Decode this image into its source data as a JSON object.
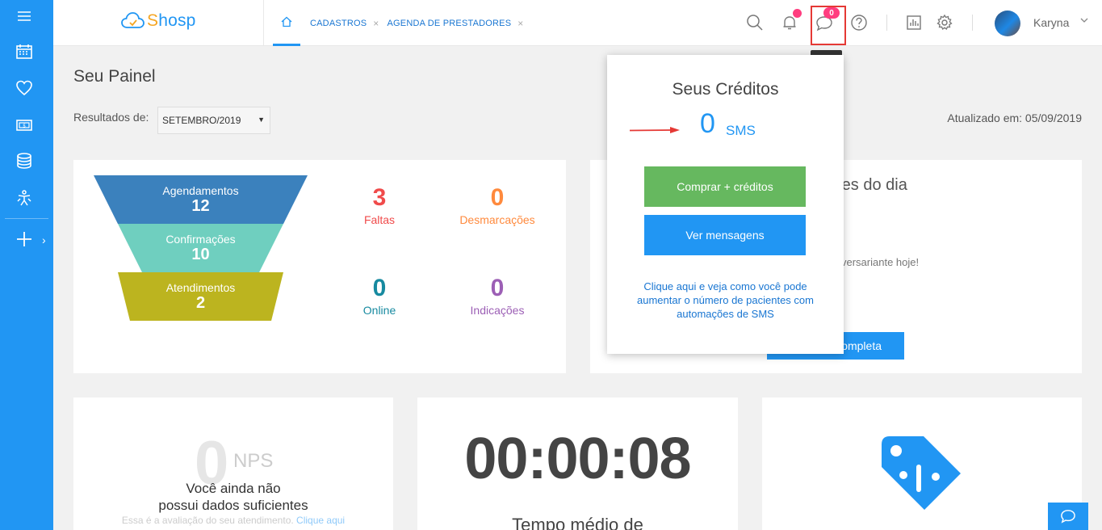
{
  "app": {
    "logo_text_s": "S",
    "logo_text_rest": "hosp"
  },
  "tabs": [
    {
      "label": "CADASTROS"
    },
    {
      "label": "AGENDA DE PRESTADORES"
    }
  ],
  "tab_close": "×",
  "topbar": {
    "sms_count": "0",
    "user_name": "Karyna",
    "tooltip": "SMS"
  },
  "page": {
    "title": "Seu Painel",
    "results_label": "Resultados de:",
    "results_value": "SETEMBRO/2019",
    "updated": "Atualizado em: 05/09/2019"
  },
  "funnel": [
    {
      "label": "Agendamentos",
      "value": "12",
      "color": "#3b81bd"
    },
    {
      "label": "Confirmações",
      "value": "10",
      "color": "#6fcfbf"
    },
    {
      "label": "Atendimentos",
      "value": "2",
      "color": "#bcb41f"
    }
  ],
  "stats": [
    {
      "value": "3",
      "label": "Faltas",
      "color": "#f04b4b"
    },
    {
      "value": "0",
      "label": "Desmarcações",
      "color": "#ff8a3d"
    },
    {
      "value": "0",
      "label": "Online",
      "color": "#178aa0"
    },
    {
      "value": "0",
      "label": "Indicações",
      "color": "#9c5fb5"
    }
  ],
  "birthday_card": {
    "title_partial": "ntes do dia",
    "text_partial": "versariante hoje!",
    "button_partial": "ompleta"
  },
  "popup": {
    "title": "Seus Créditos",
    "count": "0",
    "unit": "SMS",
    "buy_button": "Comprar + créditos",
    "messages_button": "Ver mensagens",
    "link_text": "Clique aqui e veja como você pode aumentar o número de pacientes com automações de SMS",
    "buy_color": "#66b85f",
    "messages_color": "#2196f3"
  },
  "nps": {
    "value": "0",
    "label": "NPS",
    "text_line1": "Você ainda não",
    "text_line2": "possui dados suficientes",
    "sub_text": "Essa é a avaliação do seu atendimento.",
    "sub_link": "Clique aqui"
  },
  "timer": {
    "value": "00:00:08",
    "label": "Tempo médio de"
  },
  "colors": {
    "primary": "#2196f3",
    "accent_pink": "#ff3d7f",
    "highlight_red": "#e53935"
  },
  "icons": {
    "sidebar": [
      "menu-icon",
      "calendar-icon",
      "heart-icon",
      "money-icon",
      "database-icon",
      "accessibility-icon",
      "plus-icon"
    ],
    "topbar": [
      "search-icon",
      "bell-icon",
      "chat-bubble-icon",
      "help-icon",
      "report-icon",
      "gear-icon",
      "chevron-down-icon"
    ]
  }
}
